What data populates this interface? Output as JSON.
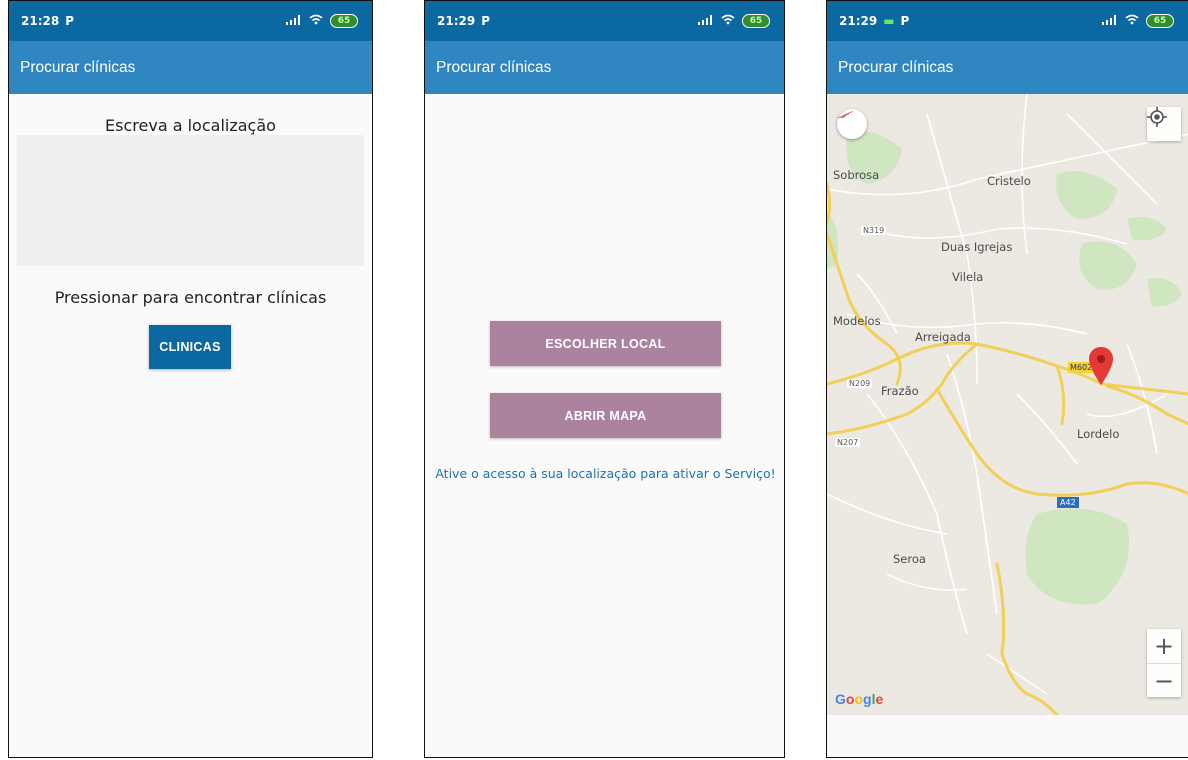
{
  "screens": [
    {
      "status": {
        "time": "21:28",
        "battery": "65"
      },
      "appbar": {
        "title": "Procurar clínicas"
      },
      "location_label": "Escreva a localização",
      "location_input": {
        "value": "",
        "placeholder": ""
      },
      "find_label": "Pressionar para encontrar clínicas",
      "clinicas_button": "CLINICAS"
    },
    {
      "status": {
        "time": "21:29",
        "battery": "65"
      },
      "appbar": {
        "title": "Procurar clínicas"
      },
      "choose_button": "ESCOLHER LOCAL",
      "open_map_button": "ABRIR MAPA",
      "location_message": "Ative o acesso à sua localização para ativar o Serviço!"
    },
    {
      "status": {
        "time": "21:29",
        "battery": "65"
      },
      "appbar": {
        "title": "Procurar clínicas"
      },
      "map": {
        "places": [
          "Sobrosa",
          "Cristelo",
          "Duas Igrejas",
          "Vilela",
          "Modelos",
          "Arreigada",
          "Frazão",
          "Lordelo",
          "Seroa"
        ],
        "roads": [
          "N319",
          "N209",
          "N207",
          "M602",
          "A42"
        ],
        "attribution": "Google",
        "zoom_in": "+",
        "zoom_out": "−"
      }
    }
  ],
  "colors": {
    "status_bar": "#0c68a0",
    "app_bar": "#2f86c1",
    "primary_button": "#0c68a0",
    "secondary_button": "#ac839f",
    "message_text": "#1a74b0",
    "map_pin": "#e53935"
  },
  "icons": [
    "signal-icon",
    "wifi-icon",
    "battery-icon",
    "compass-icon",
    "my-location-icon",
    "map-pin-icon",
    "notification-p-icon"
  ]
}
